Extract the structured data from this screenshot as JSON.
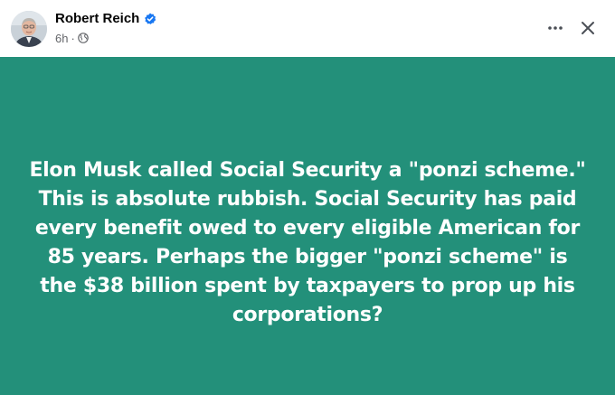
{
  "header": {
    "author_name": "Robert Reich",
    "timestamp": "6h",
    "separator": "·",
    "verified_icon": "verified-badge-icon",
    "audience_icon": "globe-icon",
    "more_icon": "more-options-icon",
    "close_icon": "close-icon"
  },
  "post": {
    "background_color": "#23907a",
    "text_color": "#ffffff",
    "text": "Elon Musk called Social Security a \"ponzi scheme.\" This is absolute rubbish. Social Security has paid every benefit owed to every eligible American for 85 years. Perhaps the bigger \"ponzi scheme\" is the $38 billion spent by taxpayers to prop up his corporations?"
  },
  "colors": {
    "verified_blue": "#1877f2",
    "meta_gray": "#65676b",
    "name_black": "#050505"
  }
}
